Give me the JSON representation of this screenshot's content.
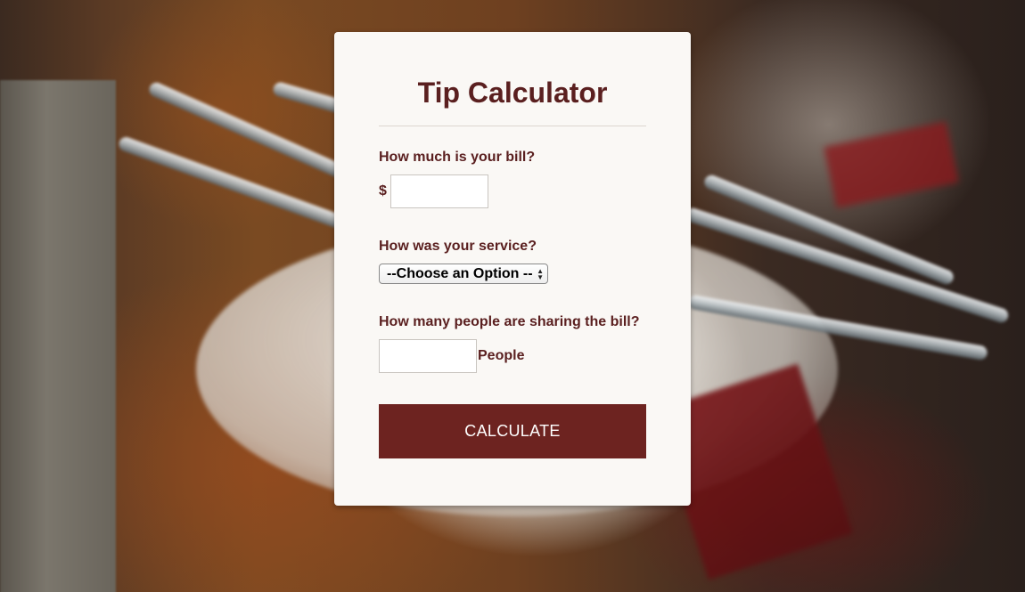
{
  "app": {
    "title": "Tip Calculator"
  },
  "bill": {
    "label": "How much is your bill?",
    "currency_symbol": "$",
    "value": "",
    "placeholder": ""
  },
  "service": {
    "label": "How was your service?",
    "selected": "--Choose an Option --"
  },
  "people": {
    "label": "How many people are sharing the bill?",
    "value": "",
    "placeholder": "",
    "unit": "People"
  },
  "calculate_button": {
    "label": "CALCULATE"
  },
  "colors": {
    "accent": "#6d2320",
    "text": "#5a1f1f",
    "card_background": "#faf8f5"
  }
}
